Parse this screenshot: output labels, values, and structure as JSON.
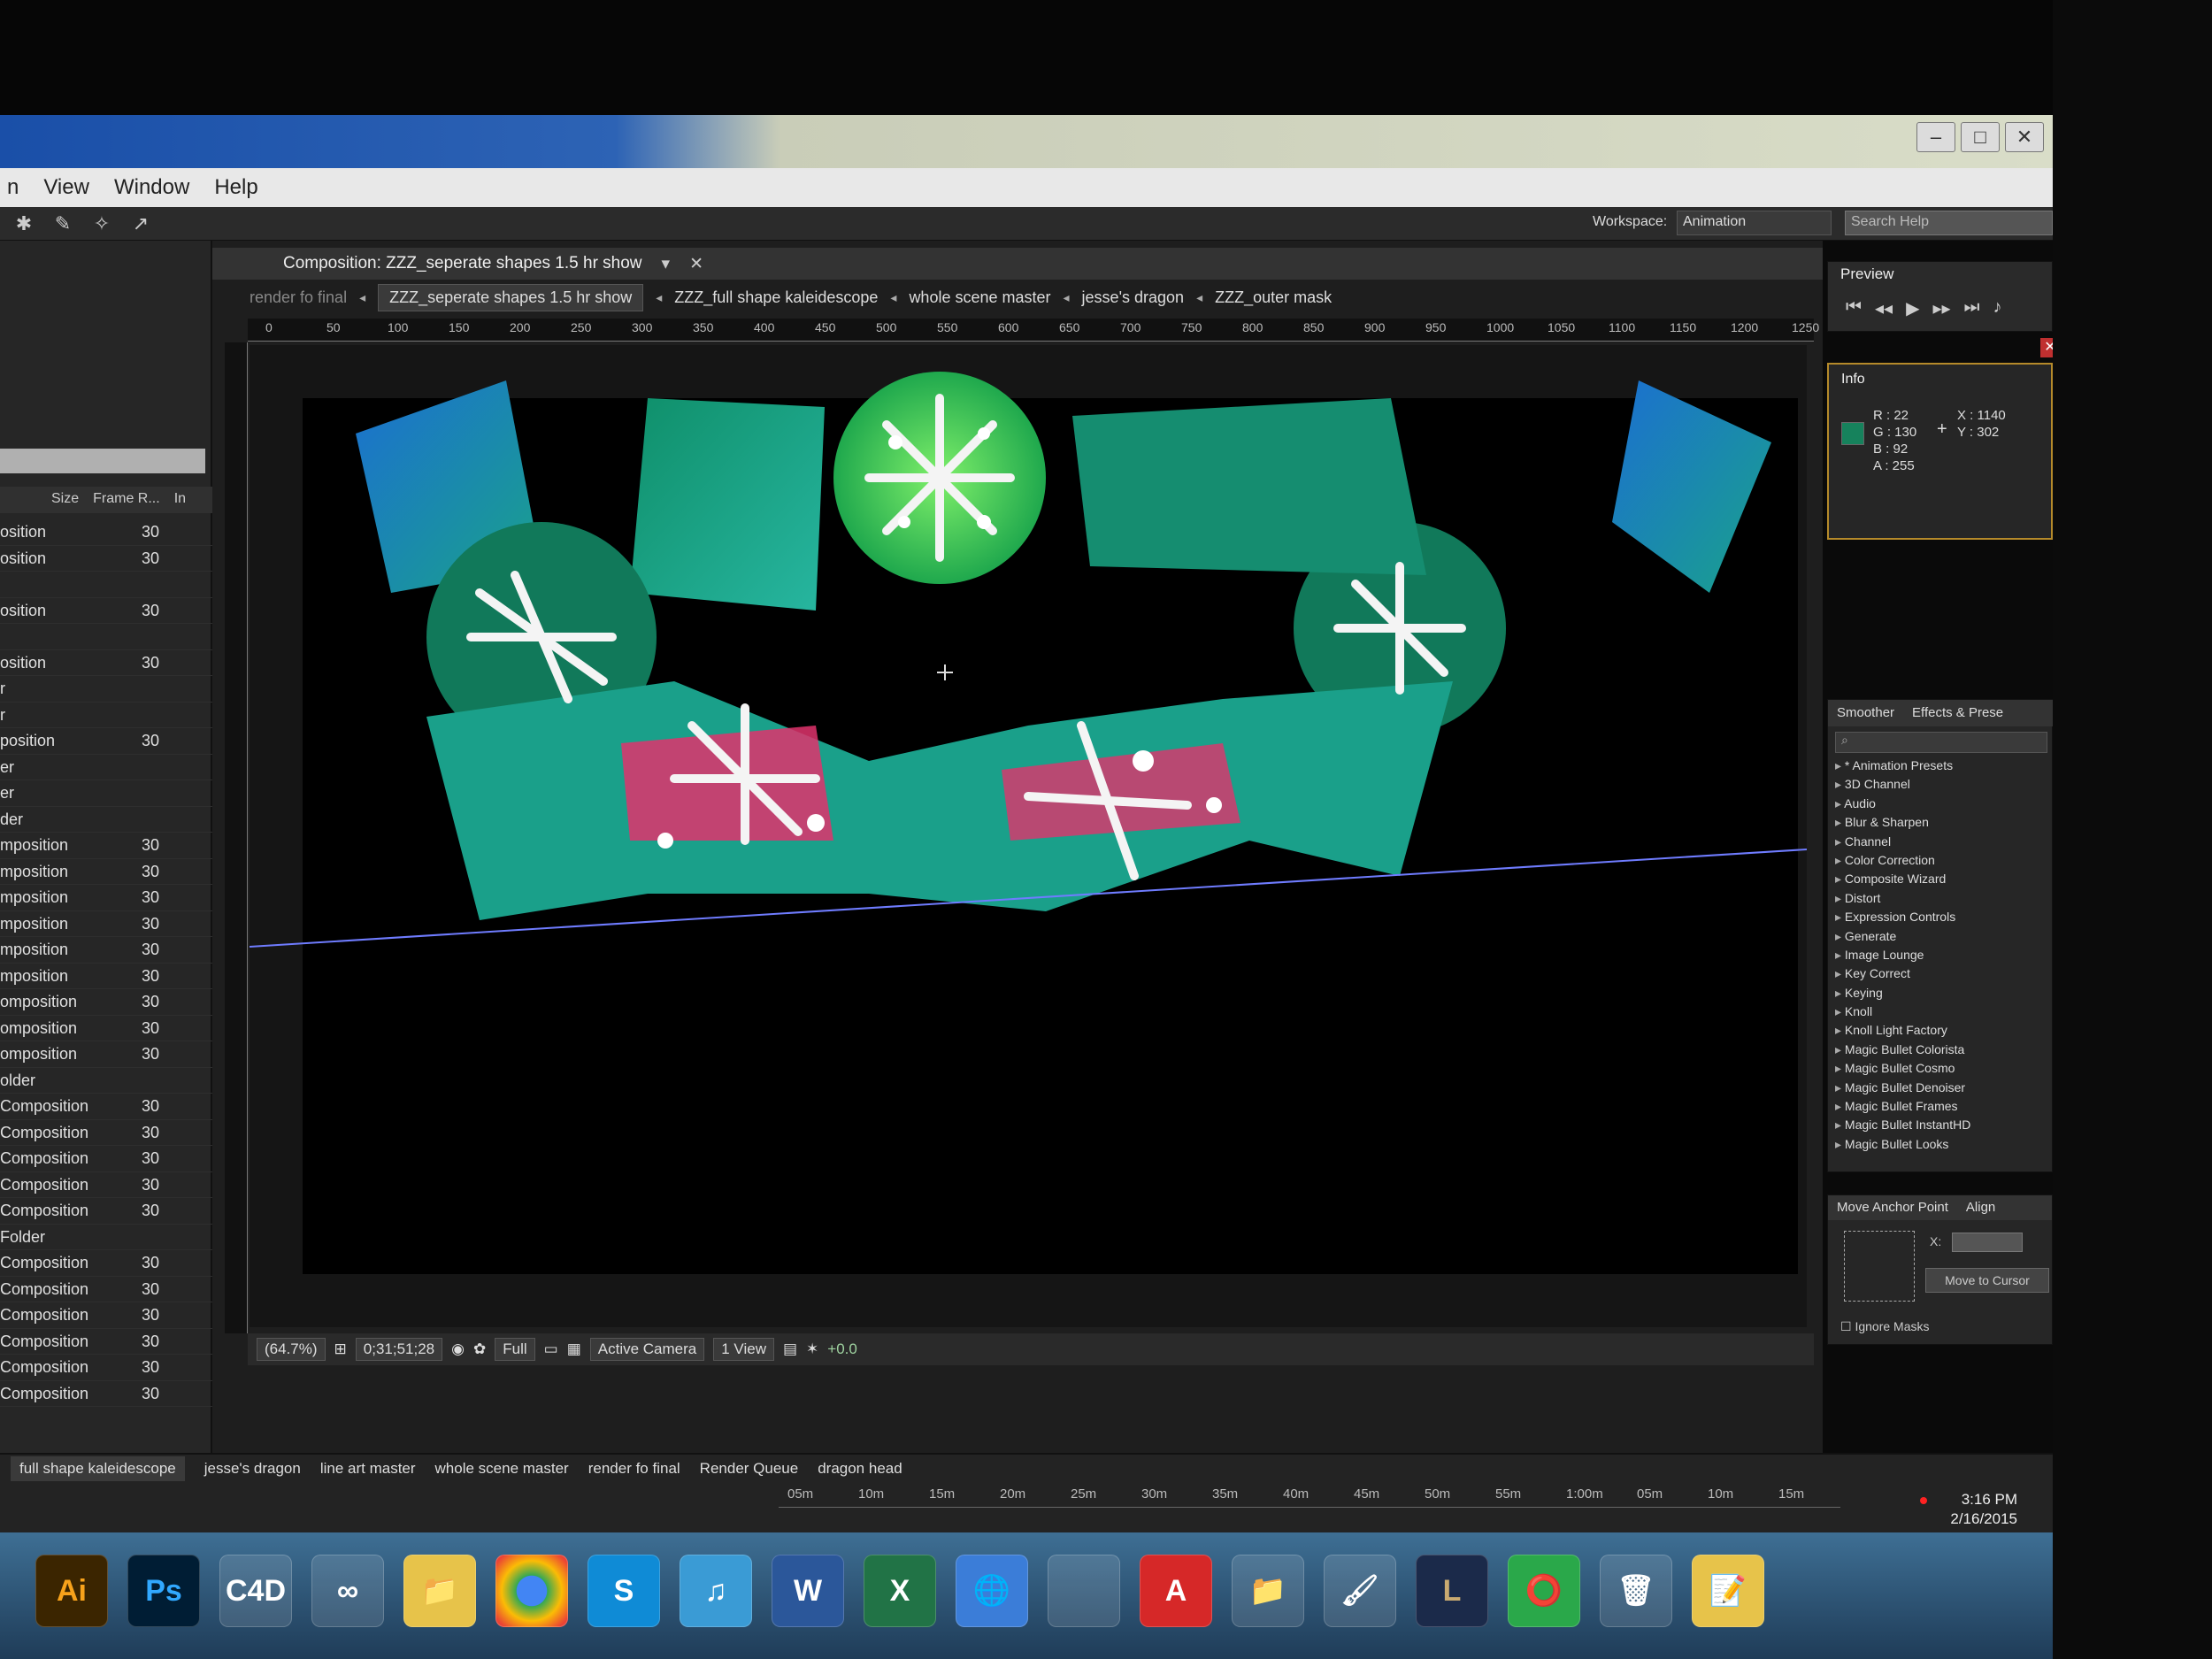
{
  "menu": {
    "items": [
      "n",
      "View",
      "Window",
      "Help"
    ]
  },
  "toolbar": {
    "workspace_label": "Workspace:",
    "workspace_value": "Animation",
    "search_placeholder": "Search Help"
  },
  "project": {
    "columns": [
      "Size",
      "Frame R...",
      "In"
    ],
    "rows": [
      {
        "name": "osition",
        "fr": "30"
      },
      {
        "name": "osition",
        "fr": "30"
      },
      {
        "name": "",
        "fr": ""
      },
      {
        "name": "osition",
        "fr": "30"
      },
      {
        "name": "",
        "fr": ""
      },
      {
        "name": "osition",
        "fr": "30"
      },
      {
        "name": "r",
        "fr": ""
      },
      {
        "name": "r",
        "fr": ""
      },
      {
        "name": "position",
        "fr": "30"
      },
      {
        "name": "er",
        "fr": ""
      },
      {
        "name": "er",
        "fr": ""
      },
      {
        "name": "der",
        "fr": ""
      },
      {
        "name": "mposition",
        "fr": "30"
      },
      {
        "name": "mposition",
        "fr": "30"
      },
      {
        "name": "mposition",
        "fr": "30"
      },
      {
        "name": "mposition",
        "fr": "30"
      },
      {
        "name": "mposition",
        "fr": "30"
      },
      {
        "name": "mposition",
        "fr": "30"
      },
      {
        "name": "omposition",
        "fr": "30"
      },
      {
        "name": "omposition",
        "fr": "30"
      },
      {
        "name": "omposition",
        "fr": "30"
      },
      {
        "name": "older",
        "fr": ""
      },
      {
        "name": "Composition",
        "fr": "30"
      },
      {
        "name": "Composition",
        "fr": "30"
      },
      {
        "name": "Composition",
        "fr": "30"
      },
      {
        "name": "Composition",
        "fr": "30"
      },
      {
        "name": "Composition",
        "fr": "30"
      },
      {
        "name": "Folder",
        "fr": ""
      },
      {
        "name": "Composition",
        "fr": "30"
      },
      {
        "name": "Composition",
        "fr": "30"
      },
      {
        "name": "Composition",
        "fr": "30"
      },
      {
        "name": "Composition",
        "fr": "30"
      },
      {
        "name": "Composition",
        "fr": "30"
      },
      {
        "name": "Composition",
        "fr": "30"
      }
    ]
  },
  "composition": {
    "title": "Composition: ZZZ_seperate shapes 1.5 hr show",
    "breadcrumbs": [
      "render fo final",
      "ZZZ_seperate shapes 1.5 hr show",
      "ZZZ_full shape kaleidescope",
      "whole scene master",
      "jesse's dragon",
      "ZZZ_outer mask"
    ],
    "ruler_ticks": [
      "0",
      "50",
      "100",
      "150",
      "200",
      "250",
      "300",
      "350",
      "400",
      "450",
      "500",
      "550",
      "600",
      "650",
      "700",
      "750",
      "800",
      "850",
      "900",
      "950",
      "1000",
      "1050",
      "1100",
      "1150",
      "1200",
      "1250"
    ],
    "viewbar": {
      "zoom": "(64.7%)",
      "timecode": "0;31;51;28",
      "resolution": "Full",
      "camera": "Active Camera",
      "views": "1 View",
      "exposure": "+0.0"
    }
  },
  "preview": {
    "tab": "Preview"
  },
  "info": {
    "tab": "Info",
    "r": "R : 22",
    "g": "G : 130",
    "b": "B : 92",
    "a": "A : 255",
    "x": "X : 1140",
    "y": "Y : 302",
    "swatch_color": "#16825c"
  },
  "effects": {
    "tabs": [
      "Smoother",
      "Effects & Prese"
    ],
    "items": [
      "* Animation Presets",
      "3D Channel",
      "Audio",
      "Blur & Sharpen",
      "Channel",
      "Color Correction",
      "Composite Wizard",
      "Distort",
      "Expression Controls",
      "Generate",
      "Image Lounge",
      "Key Correct",
      "Keying",
      "Knoll",
      "Knoll Light Factory",
      "Magic Bullet Colorista",
      "Magic Bullet Cosmo",
      "Magic Bullet Denoiser",
      "Magic Bullet Frames",
      "Magic Bullet InstantHD",
      "Magic Bullet Looks"
    ]
  },
  "align": {
    "tabs": [
      "Move Anchor Point",
      "Align"
    ],
    "x_label": "X:",
    "button": "Move to Cursor",
    "ignore_masks": "Ignore Masks"
  },
  "timeline": {
    "tabs": [
      "full shape kaleidescope",
      "jesse's dragon",
      "line art master",
      "whole scene master",
      "render fo final",
      "Render Queue",
      "dragon head"
    ],
    "time_ticks": [
      "05m",
      "10m",
      "15m",
      "20m",
      "25m",
      "30m",
      "35m",
      "40m",
      "45m",
      "50m",
      "55m",
      "1:00m",
      "05m",
      "10m",
      "15m"
    ],
    "clock_time": "3:16 PM",
    "clock_date": "2/16/2015"
  },
  "taskbar": {
    "apps": [
      "Ai",
      "Ps",
      "C4D",
      "∞",
      "📁",
      "",
      "S",
      "♫",
      "W",
      "X",
      "🌐",
      "",
      "A",
      "📁",
      "🖌",
      "L",
      "⭕",
      "🗑",
      "📝"
    ]
  }
}
